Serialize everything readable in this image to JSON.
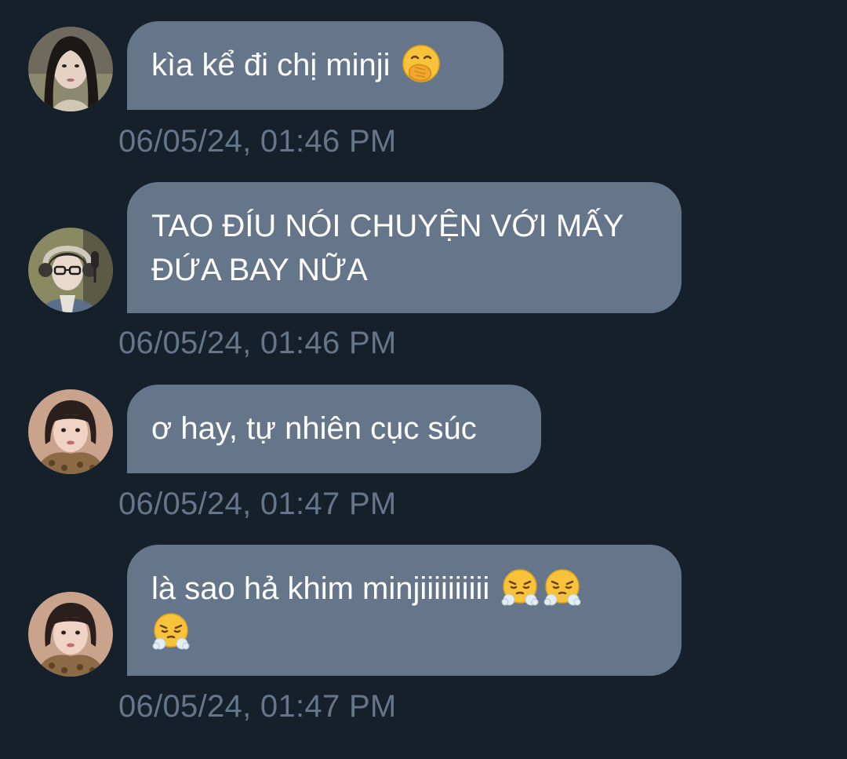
{
  "conversation": {
    "messages": [
      {
        "sender_avatar": "avatar-1",
        "text": "kìa kể đi chị minji",
        "emojis": [
          "hand-over-mouth-emoji"
        ],
        "timestamp": "06/05/24, 01:46 PM"
      },
      {
        "sender_avatar": "avatar-2",
        "text_lines": [
          "TAO ĐÍU NÓI CHUYỆN VỚI MẤY",
          "ĐỨA BAY NỮA"
        ],
        "timestamp": "06/05/24, 01:46 PM"
      },
      {
        "sender_avatar": "avatar-3",
        "text": "ơ hay, tự nhiên cục súc",
        "timestamp": "06/05/24, 01:47 PM"
      },
      {
        "sender_avatar": "avatar-3",
        "text": "là sao hả khim minjiiiiiiiiii",
        "emojis": [
          "face-with-steam-emoji",
          "face-with-steam-emoji",
          "face-with-steam-emoji"
        ],
        "timestamp": "06/05/24, 01:47 PM"
      }
    ]
  },
  "colors": {
    "background": "#15202b",
    "bubble": "#66768a",
    "bubble_text": "#ffffff",
    "timestamp": "#66768a"
  }
}
